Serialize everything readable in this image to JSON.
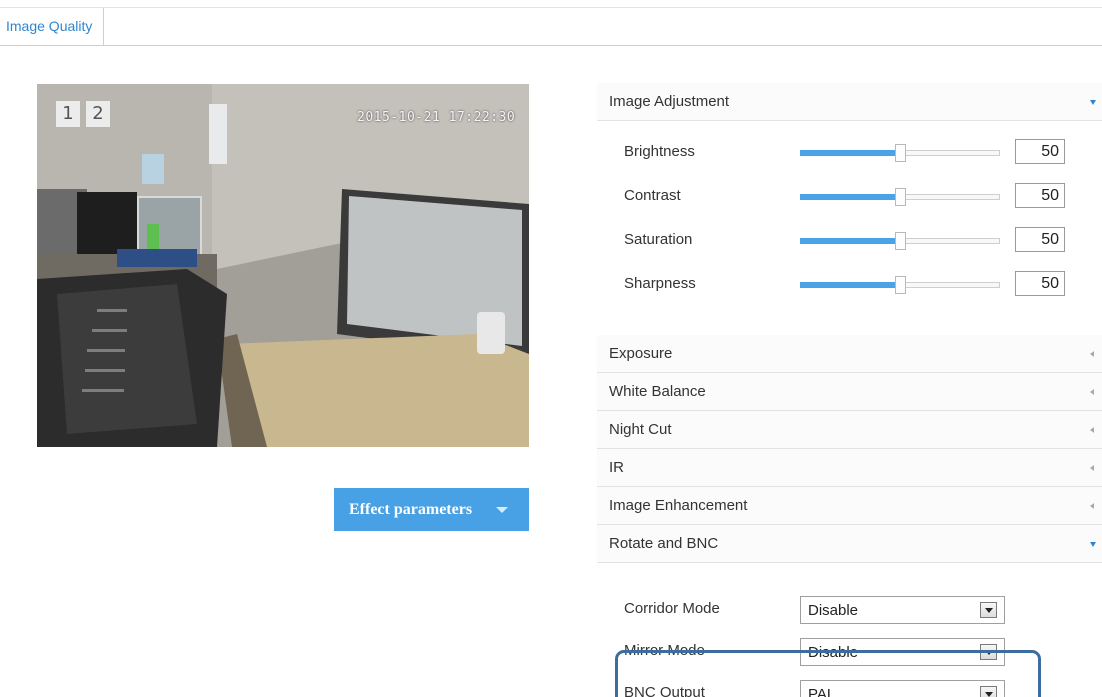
{
  "tabs": [
    {
      "label": "Image Quality"
    }
  ],
  "preview": {
    "channels": [
      "1",
      "2"
    ],
    "timestamp": "2015-10-21 17:22:30"
  },
  "effect_button": {
    "label": "Effect parameters"
  },
  "image_adjustment": {
    "title": "Image Adjustment",
    "expanded": true,
    "sliders": [
      {
        "label": "Brightness",
        "value": "50",
        "level": 50
      },
      {
        "label": "Contrast",
        "value": "50",
        "level": 50
      },
      {
        "label": "Saturation",
        "value": "50",
        "level": 50
      },
      {
        "label": "Sharpness",
        "value": "50",
        "level": 50
      }
    ]
  },
  "sections": [
    {
      "title": "Exposure",
      "expanded": false
    },
    {
      "title": "White Balance",
      "expanded": false
    },
    {
      "title": "Night Cut",
      "expanded": false
    },
    {
      "title": "IR",
      "expanded": false
    },
    {
      "title": "Image Enhancement",
      "expanded": false
    }
  ],
  "rotate_bnc": {
    "title": "Rotate and BNC",
    "expanded": true,
    "fields": [
      {
        "label": "Corridor Mode",
        "value": "Disable"
      },
      {
        "label": "Mirror Mode",
        "value": "Disable"
      },
      {
        "label": "BNC Output",
        "value": "PAL"
      }
    ]
  },
  "colors": {
    "accent": "#2f86d0",
    "button": "#47a1e4",
    "slider_fill": "#4ba3e6",
    "highlight": "#3b6e9f"
  }
}
